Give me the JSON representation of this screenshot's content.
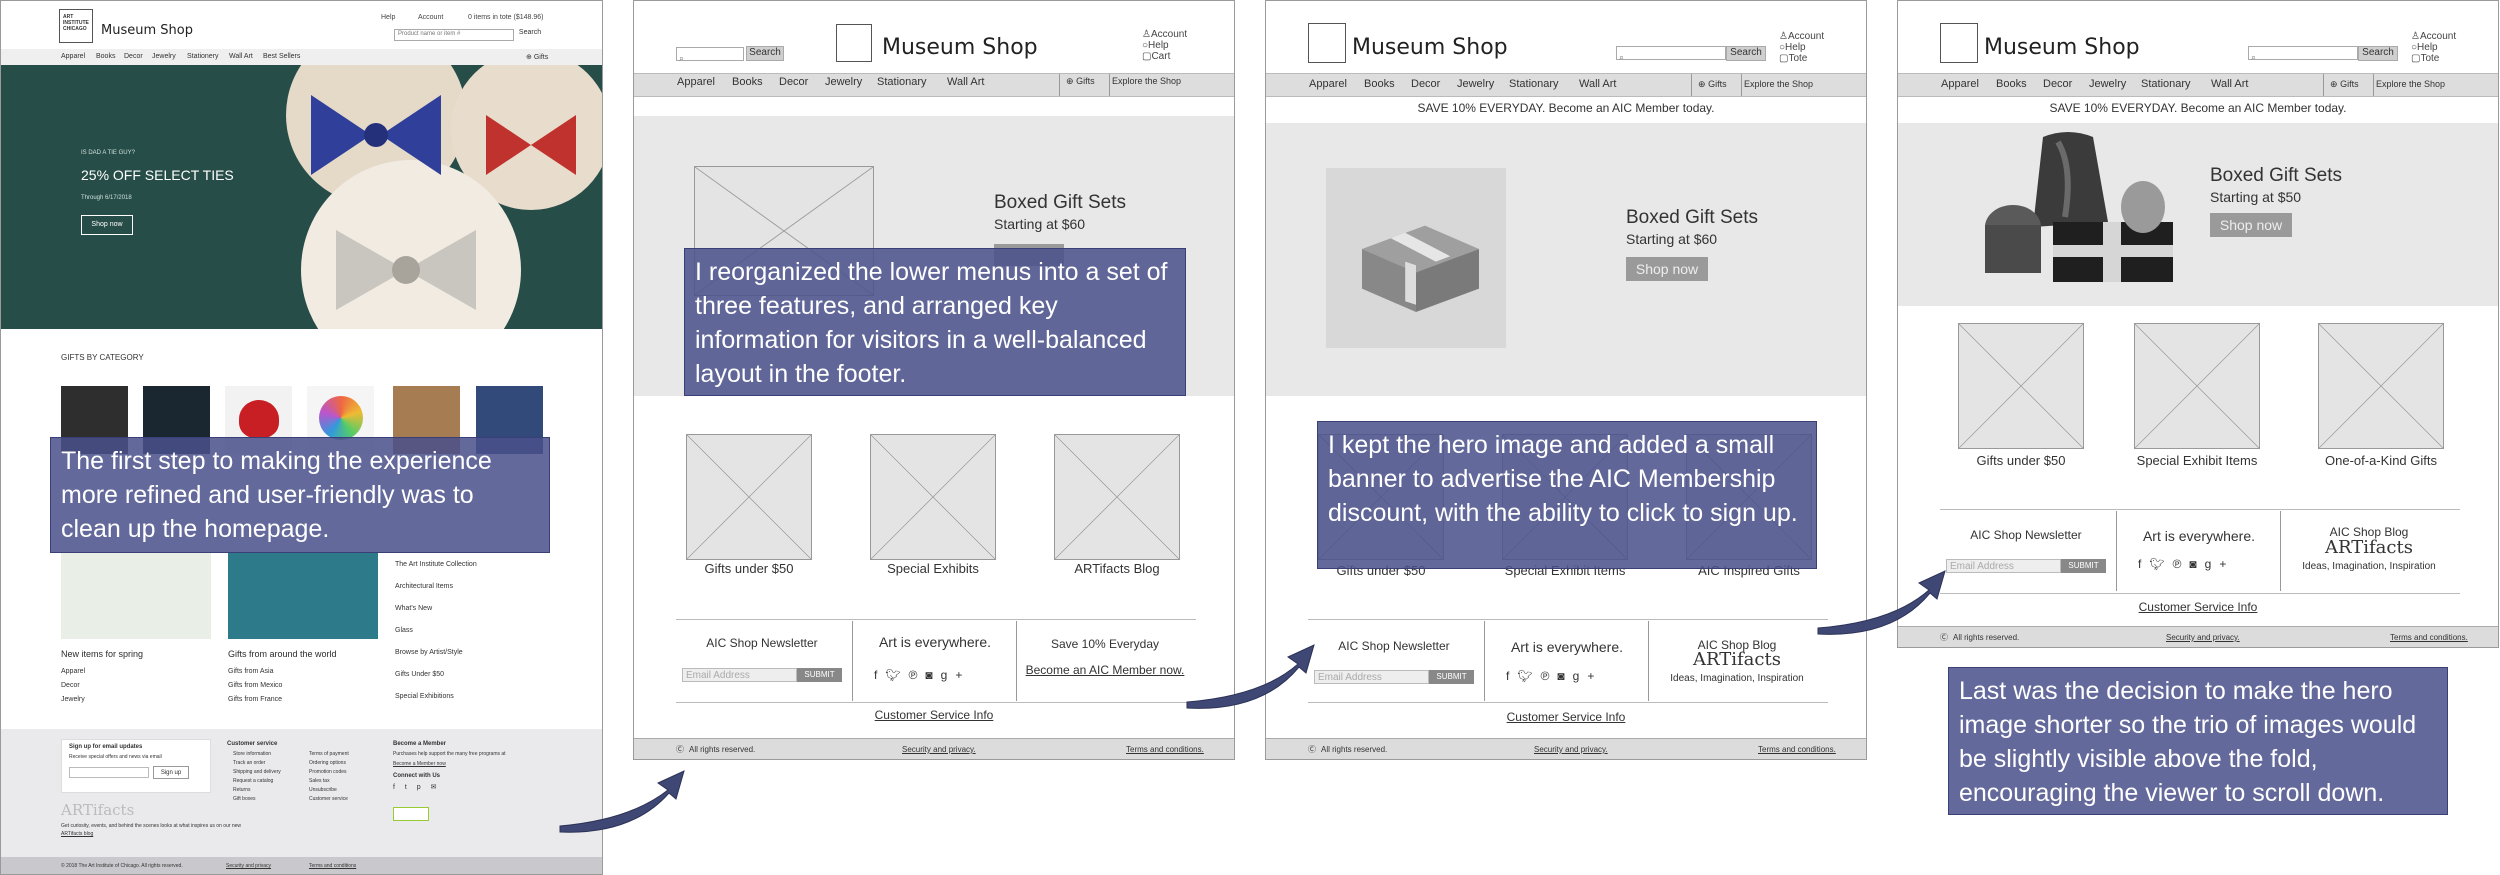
{
  "colors": {
    "note_bg": "#4b508c",
    "hero_green": "#264d48",
    "nav_grey": "#dddddd",
    "hero_grey": "#e8e8e8",
    "arrow": "#3f4774"
  },
  "panel1": {
    "brand": "Museum Shop",
    "logo_text": "ART INSTITUTE CHICAGO",
    "utility": [
      "Help",
      "Account",
      "0 items in tote ($148.96)"
    ],
    "search_placeholder": "Product name or item #",
    "search_button": "Search",
    "nav": [
      "Apparel",
      "Books",
      "Decor",
      "Jewelry",
      "Stationery",
      "Wall Art",
      "Best Sellers"
    ],
    "gifts_label": "Gifts",
    "hero_kicker": "IS DAD A TIE GUY?",
    "hero_title": "25% OFF SELECT TIES",
    "hero_date": "Through 6/17/2018",
    "hero_button": "Shop now",
    "gifts_heading": "GIFTS BY CATEGORY",
    "new_items_title": "New items for spring",
    "new_items_links": [
      "Apparel",
      "Decor",
      "Jewelry"
    ],
    "world_title": "Gifts from around the world",
    "world_links": [
      "Gifts from Asia",
      "Gifts from Mexico",
      "Gifts from France"
    ],
    "side_links": [
      "The Art Institute Collection",
      "Architectural Items",
      "What's New",
      "Glass",
      "Browse by Artist/Style",
      "Gifts Under $50",
      "Special Exhibitions"
    ],
    "signup_title": "Sign up for email updates",
    "signup_sub": "Receive special offers and news via email",
    "signup_button": "Sign up",
    "customer_service_title": "Customer service",
    "customer_service_links": [
      "Store information",
      "Track an order",
      "Shipping and delivery",
      "Request a catalog",
      "Returns",
      "Gift boxes"
    ],
    "col2_links": [
      "Terms of payment",
      "Ordering options",
      "Promotion codes",
      "Sales tax",
      "Unsubscribe",
      "Customer service"
    ],
    "member_title": "Become a Member",
    "member_text": "Purchases help support the many free programs at",
    "member_link": "Become a Member now",
    "connect_title": "Connect with Us",
    "artifacts_logo": "ARTifacts",
    "artifacts_text": "Get curiosity, events, and behind the scenes looks at what inspires us on our new",
    "artifacts_link": "ARTifacts blog",
    "copyright": "© 2018 The Art Institute of Chicago. All rights reserved.",
    "footer_links": [
      "Security and privacy",
      "Terms and conditions"
    ]
  },
  "panel2": {
    "brand": "Museum Shop",
    "search_button": "Search",
    "utility": [
      "Account",
      "Help",
      "Cart"
    ],
    "nav": [
      "Apparel",
      "Books",
      "Decor",
      "Jewelry",
      "Stationary",
      "Wall Art"
    ],
    "gifts_label": "Gifts",
    "explore": "Explore the Shop",
    "hero_title": "Boxed Gift Sets",
    "hero_sub": "Starting at $60",
    "tiles": [
      "Gifts under $50",
      "Special Exhibits",
      "ARTifacts Blog"
    ],
    "newsletter": "AIC Shop Newsletter",
    "email_placeholder": "Email Address",
    "submit": "SUBMIT",
    "art_everywhere": "Art is everywhere.",
    "save_title": "Save 10% Everyday",
    "save_link": "Become an AIC Member now.",
    "customer_service": "Customer Service Info",
    "rights": "All rights reserved.",
    "security": "Security and privacy.",
    "terms": "Terms and conditions."
  },
  "panel3": {
    "brand": "Museum Shop",
    "search_button": "Search",
    "utility": [
      "Account",
      "Help",
      "Tote"
    ],
    "nav": [
      "Apparel",
      "Books",
      "Decor",
      "Jewelry",
      "Stationary",
      "Wall Art"
    ],
    "gifts_label": "Gifts",
    "explore": "Explore the Shop",
    "banner": "SAVE 10% EVERYDAY. Become an AIC Member today.",
    "hero_title": "Boxed Gift Sets",
    "hero_sub": "Starting at $60",
    "hero_button": "Shop now",
    "tiles": [
      "Gifts under $50",
      "Special Exhibit Items",
      "AIC Inspired Gifts"
    ],
    "newsletter": "AIC Shop Newsletter",
    "email_placeholder": "Email Address",
    "submit": "SUBMIT",
    "art_everywhere": "Art is everywhere.",
    "blog_title": "AIC Shop Blog",
    "blog_logo": "ARTifacts",
    "blog_tagline": "Ideas, Imagination, Inspiration",
    "customer_service": "Customer Service Info",
    "rights": "All rights reserved.",
    "security": "Security and privacy.",
    "terms": "Terms and conditions."
  },
  "panel4": {
    "brand": "Museum Shop",
    "search_button": "Search",
    "utility": [
      "Account",
      "Help",
      "Tote"
    ],
    "nav": [
      "Apparel",
      "Books",
      "Decor",
      "Jewelry",
      "Stationary",
      "Wall Art"
    ],
    "gifts_label": "Gifts",
    "explore": "Explore the Shop",
    "banner": "SAVE 10% EVERYDAY. Become an AIC Member today.",
    "hero_title": "Boxed Gift Sets",
    "hero_sub": "Starting at $50",
    "hero_button": "Shop now",
    "tiles": [
      "Gifts under $50",
      "Special Exhibit Items",
      "One-of-a-Kind Gifts"
    ],
    "newsletter": "AIC Shop Newsletter",
    "email_placeholder": "Email Address",
    "submit": "SUBMIT",
    "art_everywhere": "Art is everywhere.",
    "blog_title": "AIC Shop Blog",
    "blog_logo": "ARTifacts",
    "blog_tagline": "Ideas, Imagination, Inspiration",
    "customer_service": "Customer Service Info",
    "rights": "All rights reserved.",
    "security": "Security and privacy.",
    "terms": "Terms and conditions."
  },
  "notes": {
    "note1": "The first step to making the experience more refined and user-friendly was to clean up the homepage.",
    "note2": "I reorganized the lower menus into a set of three features, and arranged key information for visitors in a well-balanced layout in the footer.",
    "note3": "I kept the hero image and added a small banner to advertise the AIC Membership discount, with the ability to click to sign up.",
    "note4": "Last was the decision to make the hero image shorter so the trio of images would be slightly visible above the fold, encouraging the viewer to scroll down."
  }
}
